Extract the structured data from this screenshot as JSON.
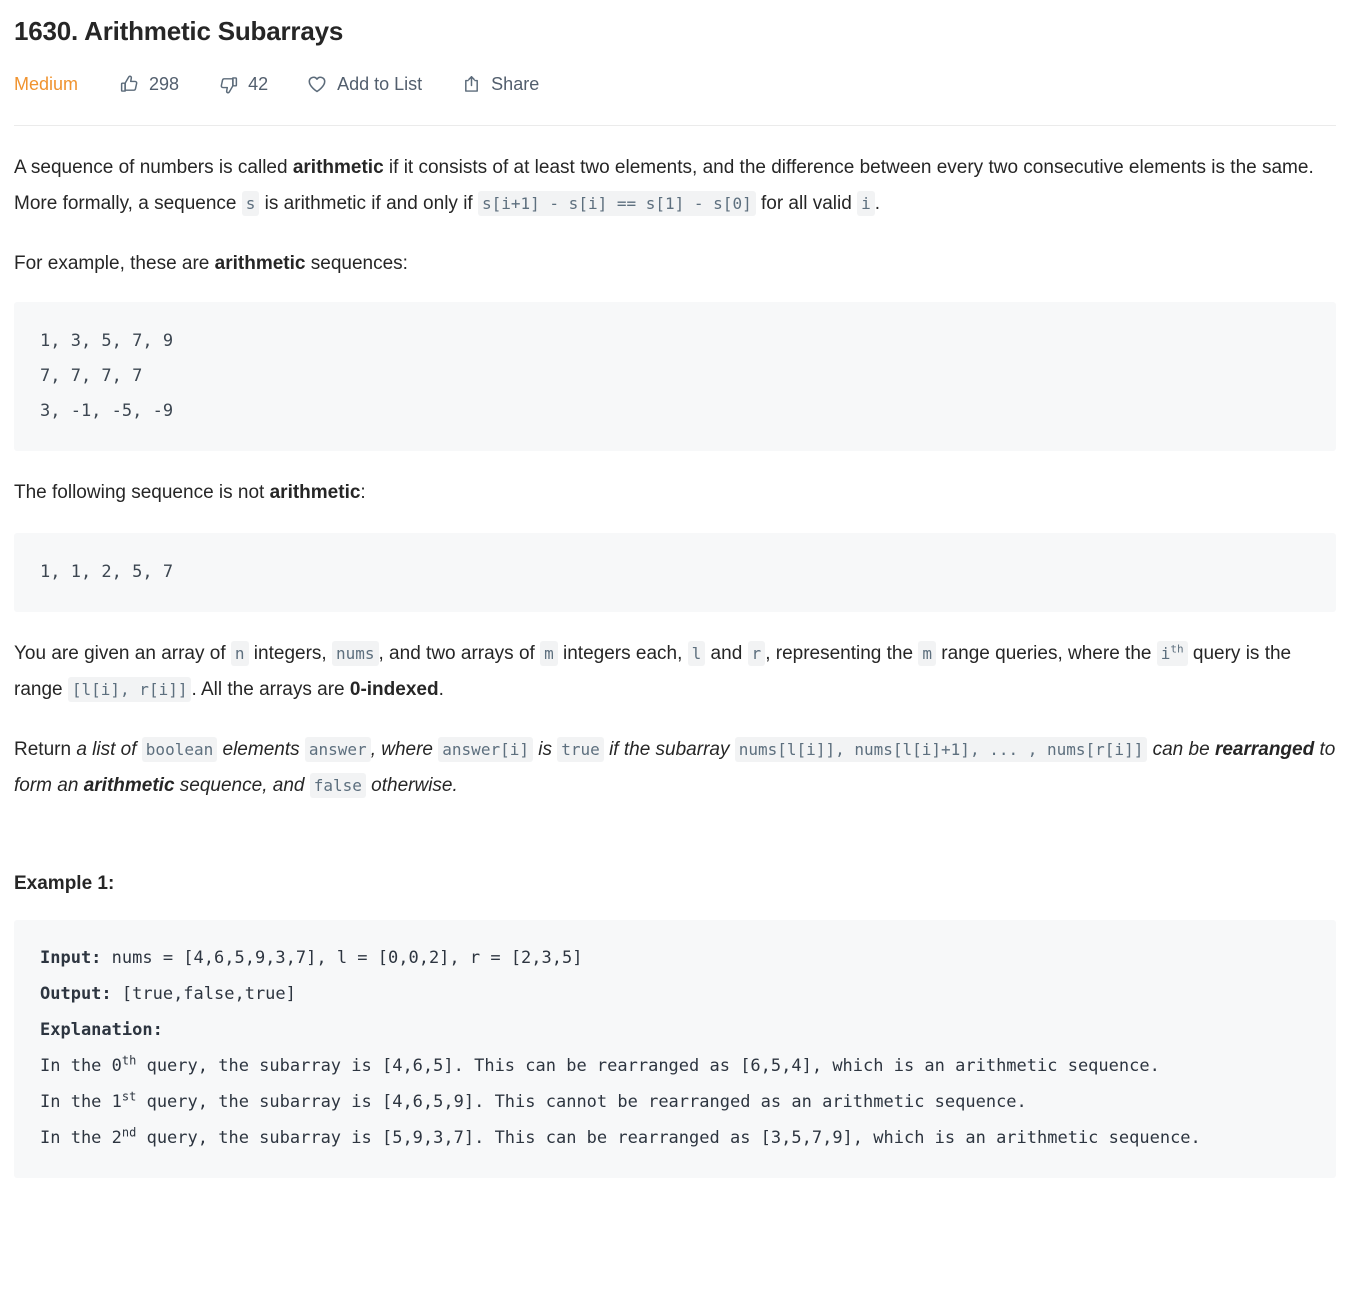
{
  "header": {
    "title": "1630. Arithmetic Subarrays",
    "difficulty": "Medium",
    "difficulty_color": "#f0932f",
    "likes": "298",
    "dislikes": "42",
    "add_to_list_label": "Add to List",
    "share_label": "Share",
    "icons": {
      "like": "thumbs-up-icon",
      "dislike": "thumbs-down-icon",
      "favorite": "heart-icon",
      "share": "share-icon"
    }
  },
  "description": {
    "p1": {
      "t1": "A sequence of numbers is called ",
      "b1": "arithmetic",
      "t2": " if it consists of at least two elements, and the difference between every two consecutive elements is the same. More formally, a sequence ",
      "c1": "s",
      "t3": " is arithmetic if and only if ",
      "c2": "s[i+1] - s[i] == s[1] - s[0]",
      "t4": " for all valid ",
      "c3": "i",
      "t5": "."
    },
    "p2": {
      "t1": "For example, these are ",
      "b1": "arithmetic",
      "t2": " sequences:"
    },
    "code1": "1, 3, 5, 7, 9\n7, 7, 7, 7\n3, -1, -5, -9",
    "p3": {
      "t1": "The following sequence is not ",
      "b1": "arithmetic",
      "t2": ":"
    },
    "code2": "1, 1, 2, 5, 7",
    "p4": {
      "t1": "You are given an array of ",
      "c1": "n",
      "t2": " integers, ",
      "c2": "nums",
      "t3": ", and two arrays of ",
      "c3": "m",
      "t4": " integers each, ",
      "c4": "l",
      "t5": " and ",
      "c5": "r",
      "t6": ", representing the ",
      "c6": "m",
      "t7": " range queries, where the ",
      "c7": "i",
      "c7sup": "th",
      "t8": " query is the range ",
      "c8": "[l[i], r[i]]",
      "t9": ". All the arrays are ",
      "b1": "0-indexed",
      "t10": "."
    },
    "p5": {
      "t1": "Return ",
      "e1": "a list of ",
      "c1": "boolean",
      "e2": " elements ",
      "c2": "answer",
      "e3": ", where ",
      "c3": "answer[i]",
      "e4": " is ",
      "c4": "true",
      "e5": " if the subarray ",
      "c5": "nums[l[i]], nums[l[i]+1], ... , nums[r[i]]",
      "e6": " can be ",
      "eb1": "rearranged",
      "e7": " to form an ",
      "eb2": "arithmetic",
      "e8": " sequence, and ",
      "c6": "false",
      "e9": " otherwise."
    }
  },
  "example1": {
    "heading": "Example 1:",
    "input_label": "Input:",
    "input_value": " nums = [4,6,5,9,3,7], l = [0,0,2], r = [2,3,5]",
    "output_label": "Output:",
    "output_value": " [true,false,true]",
    "explanation_label": "Explanation:",
    "exp_line1_a": "In the 0",
    "exp_line1_sup": "th",
    "exp_line1_b": " query, the subarray is [4,6,5]. This can be rearranged as [6,5,4], which is an arithmetic sequence.",
    "exp_line2_a": "In the 1",
    "exp_line2_sup": "st",
    "exp_line2_b": " query, the subarray is [4,6,5,9]. This cannot be rearranged as an arithmetic sequence.",
    "exp_line3_a": "In the 2",
    "exp_line3_sup": "nd",
    "exp_line3_b": " query, the subarray is [5,9,3,7]. This can be rearranged as [3,5,7,9], which is an arithmetic sequence."
  }
}
